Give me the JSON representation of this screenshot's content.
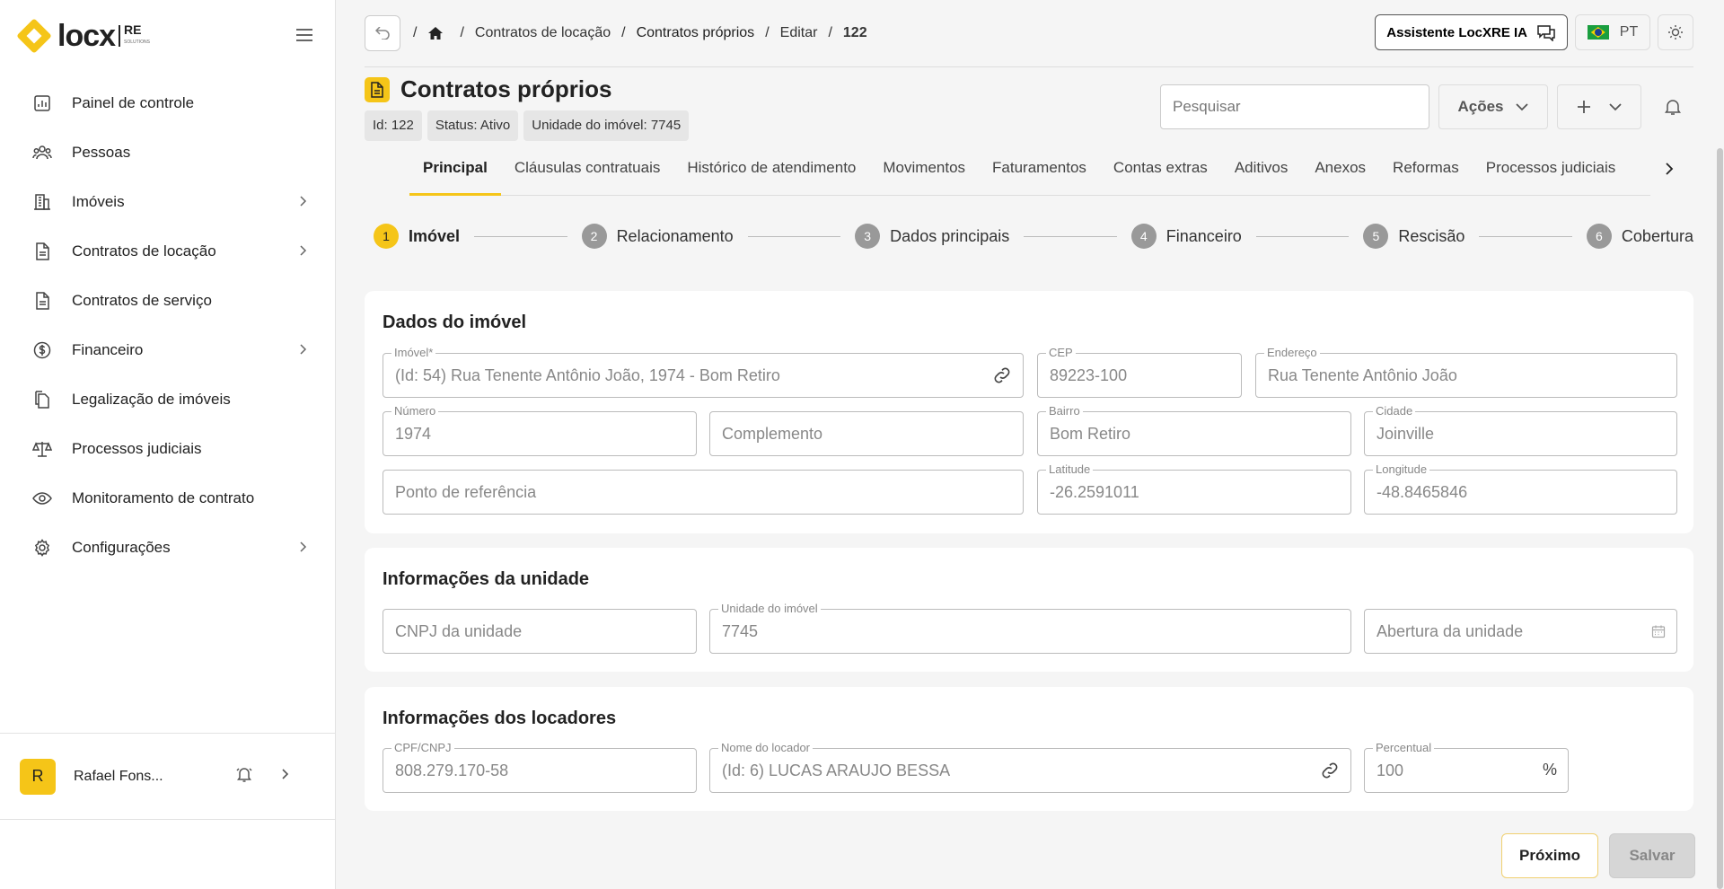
{
  "app": {
    "logo_text": "locx",
    "logo_suffix": "RE",
    "logo_tag": "SOLUTIONS"
  },
  "sidebar": {
    "items": [
      {
        "label": "Painel de controle",
        "icon": "chart-icon",
        "has_children": false
      },
      {
        "label": "Pessoas",
        "icon": "people-icon",
        "has_children": false
      },
      {
        "label": "Imóveis",
        "icon": "building-icon",
        "has_children": true
      },
      {
        "label": "Contratos de locação",
        "icon": "document-icon",
        "has_children": true
      },
      {
        "label": "Contratos de serviço",
        "icon": "document-icon",
        "has_children": false
      },
      {
        "label": "Financeiro",
        "icon": "dollar-icon",
        "has_children": true
      },
      {
        "label": "Legalização de imóveis",
        "icon": "documents-icon",
        "has_children": false
      },
      {
        "label": "Processos judiciais",
        "icon": "scales-icon",
        "has_children": false
      },
      {
        "label": "Monitoramento de contrato",
        "icon": "eye-icon",
        "has_children": false
      },
      {
        "label": "Configurações",
        "icon": "gear-icon",
        "has_children": true
      }
    ],
    "user": {
      "initial": "R",
      "name": "Rafael Fons..."
    }
  },
  "breadcrumb": {
    "items": [
      "Contratos de locação",
      "Contratos próprios",
      "Editar",
      "122"
    ]
  },
  "topbar": {
    "assistant_label": "Assistente LocXRE IA",
    "language": "PT"
  },
  "page": {
    "title": "Contratos próprios",
    "chips": [
      "Id: 122",
      "Status: Ativo",
      "Unidade do imóvel: 7745"
    ],
    "search_placeholder": "Pesquisar",
    "actions_label": "Ações"
  },
  "tabs": [
    "Principal",
    "Cláusulas contratuais",
    "Histórico de atendimento",
    "Movimentos",
    "Faturamentos",
    "Contas extras",
    "Aditivos",
    "Anexos",
    "Reformas",
    "Processos judiciais"
  ],
  "active_tab": "Principal",
  "steps": [
    {
      "num": "1",
      "label": "Imóvel"
    },
    {
      "num": "2",
      "label": "Relacionamento"
    },
    {
      "num": "3",
      "label": "Dados principais"
    },
    {
      "num": "4",
      "label": "Financeiro"
    },
    {
      "num": "5",
      "label": "Rescisão"
    },
    {
      "num": "6",
      "label": "Cobertura"
    }
  ],
  "sections": {
    "imovel": {
      "title": "Dados do imóvel",
      "imovel_label": "Imóvel*",
      "imovel_value": "(Id: 54) Rua Tenente Antônio João, 1974 - Bom Retiro",
      "cep_label": "CEP",
      "cep_value": "89223-100",
      "endereco_label": "Endereço",
      "endereco_value": "Rua Tenente Antônio João",
      "numero_label": "Número",
      "numero_value": "1974",
      "complemento_placeholder": "Complemento",
      "bairro_label": "Bairro",
      "bairro_value": "Bom Retiro",
      "cidade_label": "Cidade",
      "cidade_value": "Joinville",
      "referencia_placeholder": "Ponto de referência",
      "latitude_label": "Latitude",
      "latitude_value": "-26.2591011",
      "longitude_label": "Longitude",
      "longitude_value": "-48.8465846"
    },
    "unidade": {
      "title": "Informações da unidade",
      "cnpj_placeholder": "CNPJ da unidade",
      "unidade_label": "Unidade do imóvel",
      "unidade_value": "7745",
      "abertura_placeholder": "Abertura da unidade"
    },
    "locadores": {
      "title": "Informações dos locadores",
      "cpf_label": "CPF/CNPJ",
      "cpf_value": "808.279.170-58",
      "nome_label": "Nome do locador",
      "nome_value": "(Id: 6) LUCAS ARAUJO BESSA",
      "percentual_label": "Percentual",
      "percentual_value": "100",
      "percent_sign": "%"
    }
  },
  "footer": {
    "next_label": "Próximo",
    "save_label": "Salvar"
  },
  "colors": {
    "accent": "#f5c518",
    "step_inactive": "#999999"
  }
}
